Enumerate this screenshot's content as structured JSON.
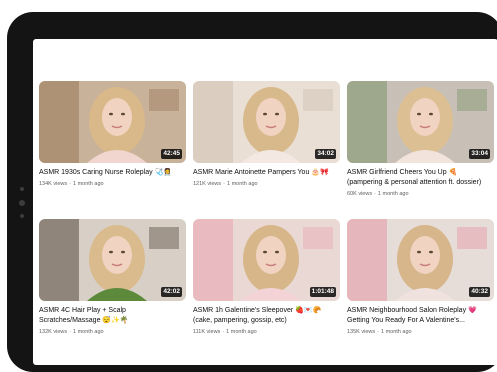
{
  "videos": [
    {
      "title": "ASMR 1930s Caring Nurse Roleplay 🩺👩‍⚕️",
      "duration": "42:45",
      "views": "134K views",
      "age": "1 month ago",
      "colors": {
        "bg": "#c9b29a",
        "accent": "#8e6a4c",
        "hair": "#d9b98a",
        "shirt": "#f1d6d0"
      }
    },
    {
      "title": "ASMR Marie Antoinette Pampers You 🎂🎀",
      "duration": "34:02",
      "views": "121K views",
      "age": "1 month ago",
      "colors": {
        "bg": "#e9dfd4",
        "accent": "#c9b8a8",
        "hair": "#d8b98c",
        "shirt": "#f4e9e2"
      }
    },
    {
      "title": "ASMR Girlfriend Cheers You Up 🍕 (pampering & personal attention ft. dossier)",
      "duration": "33:04",
      "views": "60K views",
      "age": "1 month ago",
      "colors": {
        "bg": "#c8c0b6",
        "accent": "#6a8c5a",
        "hair": "#dcbf93",
        "shirt": "#f2e3dc"
      }
    },
    {
      "title": "ASMR 4C Hair Play + Scalp Scratches/Massage 😴✨🌴",
      "duration": "42:02",
      "views": "132K views",
      "age": "1 month ago",
      "colors": {
        "bg": "#d8cfc6",
        "accent": "#3a2a20",
        "hair": "#d9bb8e",
        "shirt": "#5c8a3a"
      }
    },
    {
      "title": "ASMR 1h Galentine's Sleepover 🍓💌🥐 (cake, pampering, gossip, etc)",
      "duration": "1:01:48",
      "views": "111K views",
      "age": "1 month ago",
      "colors": {
        "bg": "#ead8d4",
        "accent": "#e89aa8",
        "hair": "#d7b78a",
        "shirt": "#f3d3d6"
      }
    },
    {
      "title": "ASMR Neighbourhood Salon Roleplay 💗 Getting You Ready For A Valentine's...",
      "duration": "40:32",
      "views": "135K views",
      "age": "1 month ago",
      "colors": {
        "bg": "#e6dcd8",
        "accent": "#e4889c",
        "hair": "#d6b68a",
        "shirt": "#f0e2de"
      }
    }
  ]
}
